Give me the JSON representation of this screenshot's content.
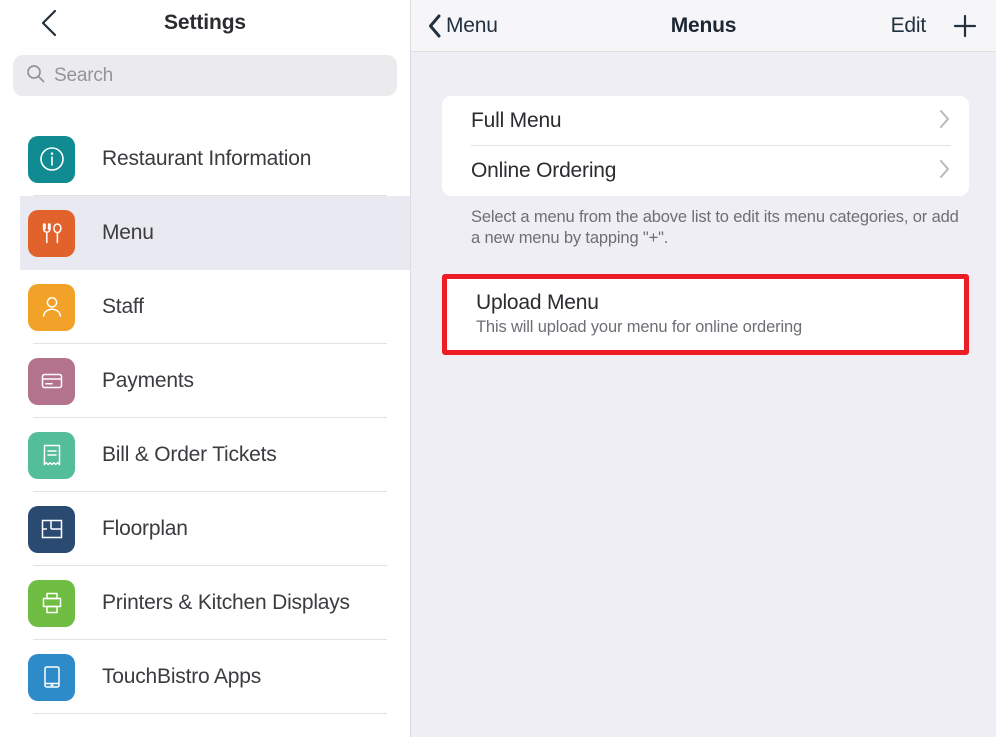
{
  "sidebar": {
    "back_icon": "chevron-left-icon",
    "title": "Settings",
    "search": {
      "icon": "search-icon",
      "placeholder": "Search",
      "value": ""
    },
    "items": [
      {
        "label": "Restaurant Information",
        "icon": "info-circle-icon",
        "color": "#0f8b91",
        "selected": false
      },
      {
        "label": "Menu",
        "icon": "fork-spoon-icon",
        "color": "#e2622b",
        "selected": true
      },
      {
        "label": "Staff",
        "icon": "person-icon",
        "color": "#f3a229",
        "selected": false
      },
      {
        "label": "Payments",
        "icon": "credit-card-icon",
        "color": "#b4738c",
        "selected": false
      },
      {
        "label": "Bill & Order Tickets",
        "icon": "receipt-icon",
        "color": "#54bd9a",
        "selected": false
      },
      {
        "label": "Floorplan",
        "icon": "floorplan-icon",
        "color": "#2b4a72",
        "selected": false
      },
      {
        "label": "Printers & Kitchen Displays",
        "icon": "printer-icon",
        "color": "#70bd44",
        "selected": false
      },
      {
        "label": "TouchBistro Apps",
        "icon": "tablet-icon",
        "color": "#2e8bca",
        "selected": false
      }
    ]
  },
  "detail": {
    "header": {
      "back_icon": "chevron-left-icon",
      "back_label": "Menu",
      "title": "Menus",
      "edit_label": "Edit",
      "add_icon": "plus-icon"
    },
    "menu_list": [
      {
        "label": "Full Menu",
        "chevron": "chevron-right-icon"
      },
      {
        "label": "Online Ordering",
        "chevron": "chevron-right-icon"
      }
    ],
    "helper_text": "Select a menu from the above list to edit its menu categories, or add a new menu by tapping \"+\".",
    "upload": {
      "title": "Upload Menu",
      "subtitle": "This will upload your menu for online ordering",
      "highlight_color": "#ee1c25"
    }
  }
}
